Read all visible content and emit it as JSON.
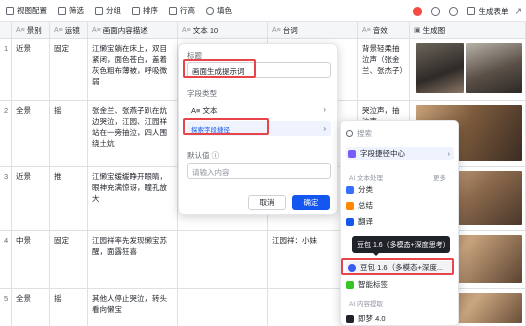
{
  "toolbar": {
    "items": [
      {
        "label": "视图配置",
        "icon": "view-icon"
      },
      {
        "label": "筛选",
        "icon": "filter-icon"
      },
      {
        "label": "分组",
        "icon": "group-icon"
      },
      {
        "label": "排序",
        "icon": "sort-icon"
      },
      {
        "label": "行高",
        "icon": "row-height-icon"
      },
      {
        "label": "填色",
        "icon": "fill-color-icon"
      }
    ],
    "generate_form": "生成表单"
  },
  "columns": [
    {
      "type": "A≡",
      "label": "景别"
    },
    {
      "type": "A≡",
      "label": "运镜"
    },
    {
      "type": "A≡",
      "label": "画面内容描述"
    },
    {
      "type": "A≡",
      "label": "文本 10"
    },
    {
      "type": "A≡",
      "label": "台词"
    },
    {
      "type": "A≡",
      "label": "音效"
    },
    {
      "type": "",
      "label": "生成图"
    }
  ],
  "rows": [
    {
      "num": "1",
      "shot": "近景",
      "move": "固定",
      "desc": "江懒宝躺在床上，双目紧闭，面色苍白，盖着灰色粗布薄被，呼吸微弱",
      "sound": "背景轻柔抽泣声（张金兰、张杰子）"
    },
    {
      "num": "2",
      "shot": "全景",
      "move": "摇",
      "desc": "张金兰、张燕子趴在炕边哭泣，江园、江园祥站在一旁抽泣，四人围绕土炕",
      "sound": "哭泣声，抽泣声"
    },
    {
      "num": "3",
      "shot": "近景",
      "move": "推",
      "desc": "江懒宝缓缓睁开眼睛，眼神充满惊讶，瞳孔放大",
      "sound": ""
    },
    {
      "num": "4",
      "shot": "中景",
      "move": "固定",
      "desc": "江园祥率先发现懒宝苏醒，面露狂喜",
      "dialog": "江园祥：小妹",
      "sound": ""
    },
    {
      "num": "5",
      "shot": "全景",
      "move": "摇",
      "desc": "其他人停止哭泣，转头看向懒宝",
      "sound": ""
    }
  ],
  "dialog": {
    "title_label": "标题",
    "title_value": "画面生成提示词",
    "type_label": "字段类型",
    "type_option_text": "A≡ 文本",
    "type_option_ai": "探索字段捷径",
    "default_label": "默认值 ⓘ",
    "default_placeholder": "请输入内容",
    "cancel": "取消",
    "confirm": "确定"
  },
  "menu": {
    "search_placeholder": "搜索",
    "shortcut_center": "字段捷径中心",
    "section_ai": "AI 文本处理",
    "more": "更多",
    "items": [
      "分类",
      "总结",
      "翻译",
      "智能标签"
    ],
    "highlight_item": "豆包 1.6（多模态+深度...",
    "section_extract": "AI 内容提取",
    "bottom_item": "即梦 4.0"
  },
  "tooltip": "豆包 1.6（多模态+深度思考）",
  "colors": {
    "accent": "#1456f0",
    "highlight": "#e8454a",
    "header_bg": "#f5f6f7",
    "ai_bg": "#eef3fe"
  }
}
